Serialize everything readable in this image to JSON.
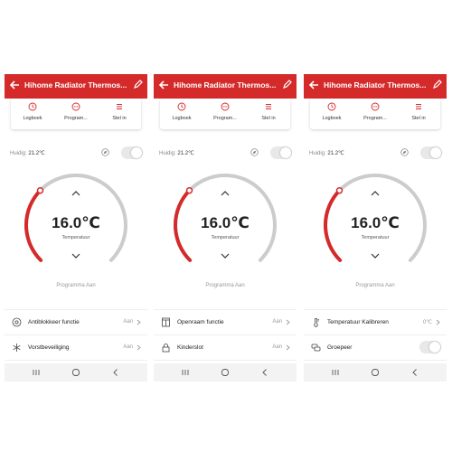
{
  "colors": {
    "brand_red": "#d52a2a",
    "arc_grey": "#cccccc",
    "toggle_off": "#e8e8e8"
  },
  "screens": [
    {
      "header": {
        "title": "Hihome Radiator Thermos..."
      },
      "tabs": [
        {
          "label": "Logboek",
          "icon": "clock-icon"
        },
        {
          "label": "Program...",
          "icon": "program-icon"
        },
        {
          "label": "Stel in",
          "icon": "settings-list-icon"
        }
      ],
      "current": {
        "label": "Huidig:",
        "value": "21.2℃"
      },
      "dial": {
        "value": "16.0℃",
        "label": "Temperatuur",
        "level_fraction": 0.33
      },
      "program_status": "Programma Aan",
      "settings": [
        {
          "label": "Antiblokkeer functie",
          "value": "Aan",
          "icon": "gear-icon",
          "control": "chevron"
        },
        {
          "label": "Vorstbeveiliging",
          "value": "Aan",
          "icon": "snowflake-icon",
          "control": "chevron"
        }
      ]
    },
    {
      "header": {
        "title": "Hihome Radiator Thermos..."
      },
      "tabs": [
        {
          "label": "Logboek",
          "icon": "clock-icon"
        },
        {
          "label": "Program...",
          "icon": "program-icon"
        },
        {
          "label": "Stel in",
          "icon": "settings-list-icon"
        }
      ],
      "current": {
        "label": "Huidig:",
        "value": "21.2℃"
      },
      "dial": {
        "value": "16.0℃",
        "label": "Temperatuur",
        "level_fraction": 0.33
      },
      "program_status": "Programma Aan",
      "settings": [
        {
          "label": "Openraam functie",
          "value": "Aan",
          "icon": "window-icon",
          "control": "chevron"
        },
        {
          "label": "Kinderslot",
          "value": "Aan",
          "icon": "lock-icon",
          "control": "chevron"
        }
      ]
    },
    {
      "header": {
        "title": "Hihome Radiator Thermos..."
      },
      "tabs": [
        {
          "label": "Logboek",
          "icon": "clock-icon"
        },
        {
          "label": "Program...",
          "icon": "program-icon"
        },
        {
          "label": "Stel in",
          "icon": "settings-list-icon"
        }
      ],
      "current": {
        "label": "Huidig:",
        "value": "21.2℃"
      },
      "dial": {
        "value": "16.0℃",
        "label": "Temperatuur",
        "level_fraction": 0.33
      },
      "program_status": "Programma Aan",
      "settings": [
        {
          "label": "Temperatuur Kalibreren",
          "value": "0℃",
          "icon": "thermometer-icon",
          "control": "chevron"
        },
        {
          "label": "Groepeer",
          "value": "",
          "icon": "group-icon",
          "control": "toggle"
        }
      ]
    }
  ]
}
